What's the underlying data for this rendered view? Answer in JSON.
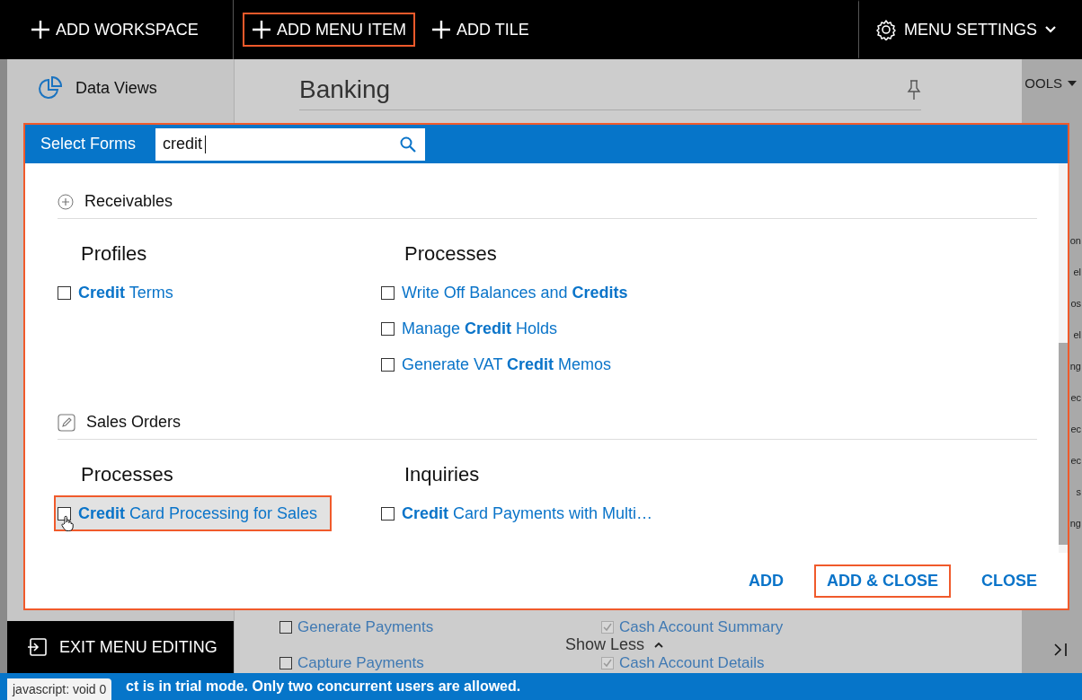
{
  "toolbar": {
    "items": [
      {
        "label": "ADD WORKSPACE",
        "highlighted": false
      },
      {
        "label": "ADD MENU ITEM",
        "highlighted": true
      },
      {
        "label": "ADD TILE",
        "highlighted": false
      }
    ],
    "settings": {
      "label": "MENU SETTINGS"
    }
  },
  "sidebar": {
    "item": "Data Views",
    "exit_button": "EXIT MENU EDITING"
  },
  "workspace": {
    "title": "Banking",
    "tools_label": "OOLS",
    "rows": [
      {
        "left": {
          "label": "Generate Payments",
          "checked": false
        },
        "right": {
          "label": "Cash Account Summary",
          "checked": true
        }
      },
      {
        "left": {
          "label": "Capture Payments",
          "checked": false
        },
        "right": {
          "label": "Cash Account Details",
          "checked": true
        }
      }
    ],
    "show_less": "Show Less",
    "edge_fragments": [
      "on",
      "el",
      "os",
      "el",
      "ng",
      "ec",
      "ec",
      "ec",
      "s",
      "ng"
    ]
  },
  "dialog": {
    "title": "Select Forms",
    "search": {
      "value": "credit"
    },
    "sections": [
      {
        "title": "Receivables",
        "kind": "plus",
        "groups": [
          {
            "heading": "Profiles",
            "items": [
              {
                "label": "**Credit** Terms",
                "checked": false,
                "selected": false
              }
            ]
          },
          {
            "heading": "Processes",
            "items": [
              {
                "label": "Write Off Balances and **Credits**",
                "checked": false,
                "selected": false
              },
              {
                "label": "Manage **Credit** Holds",
                "checked": false,
                "selected": false
              },
              {
                "label": "Generate VAT **Credit** Memos",
                "checked": false,
                "selected": false
              }
            ]
          }
        ]
      },
      {
        "title": "Sales Orders",
        "kind": "edit",
        "groups": [
          {
            "heading": "Processes",
            "items": [
              {
                "label": "**Credit** Card Processing for Sales",
                "checked": false,
                "selected": true
              }
            ]
          },
          {
            "heading": "Inquiries",
            "items": [
              {
                "label": "**Credit** Card Payments with Multi…",
                "checked": false,
                "selected": false
              }
            ]
          }
        ]
      }
    ],
    "buttons": [
      {
        "label": "ADD",
        "highlighted": false
      },
      {
        "label": "ADD & CLOSE",
        "highlighted": true
      },
      {
        "label": "CLOSE",
        "highlighted": false
      }
    ]
  },
  "status_bar": {
    "message": "ct is in trial mode. Only two concurrent users are allowed.",
    "tooltip": "javascript: void 0"
  }
}
